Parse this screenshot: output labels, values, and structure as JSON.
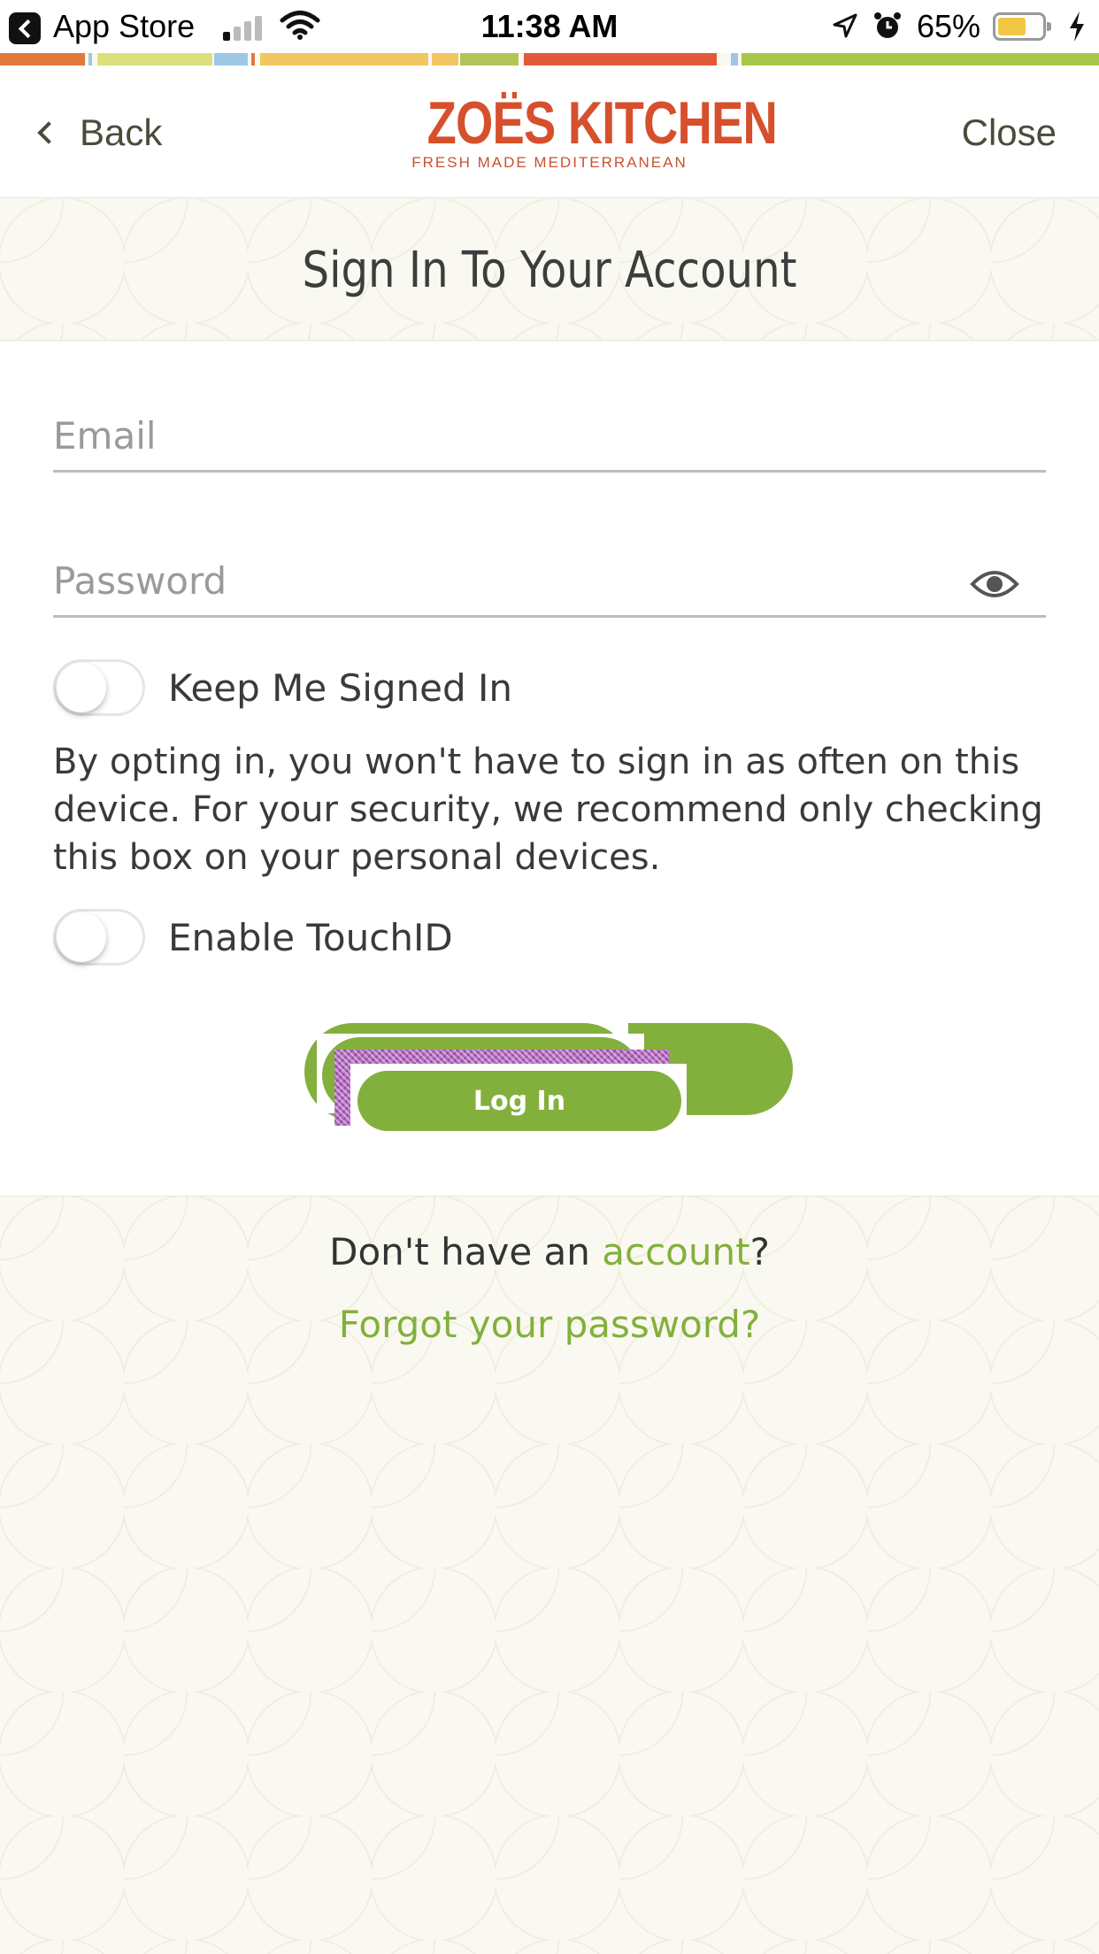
{
  "status_bar": {
    "back_app": "App Store",
    "time": "11:38 AM",
    "battery_percent": "65%",
    "battery_level": 0.65,
    "icons": [
      "back-icon",
      "signal-icon",
      "wifi-icon",
      "location-icon",
      "alarm-icon",
      "battery-icon",
      "charging-bolt-icon"
    ]
  },
  "header": {
    "back_label": "Back",
    "close_label": "Close",
    "brand_name": "ZOËS KITCHEN",
    "brand_tagline": "FRESH MADE MEDITERRANEAN"
  },
  "title": "Sign In To Your Account",
  "form": {
    "email_placeholder": "Email",
    "email_value": "",
    "password_placeholder": "Password",
    "password_value": "",
    "keep_signed_in_label": "Keep Me Signed In",
    "keep_signed_in_on": false,
    "opt_in_text": "By opting in, you won't have to sign in as often on this device. For your security, we recommend only checking this box on your personal devices.",
    "touchid_label": "Enable TouchID",
    "touchid_on": false,
    "login_label": "Log In"
  },
  "footer": {
    "signup_prefix": "Don't have an ",
    "signup_link": "account",
    "signup_suffix": "?",
    "forgot_link": "Forgot your password?"
  },
  "colors": {
    "accent_green": "#83b03c",
    "brand_red": "#d6502d",
    "stripe": [
      "#e07a3a",
      "#f2c660",
      "#dbe07c",
      "#9ec7e6",
      "#f0b45c",
      "#b3c457",
      "#e05a3a",
      "#a6c84a"
    ]
  }
}
